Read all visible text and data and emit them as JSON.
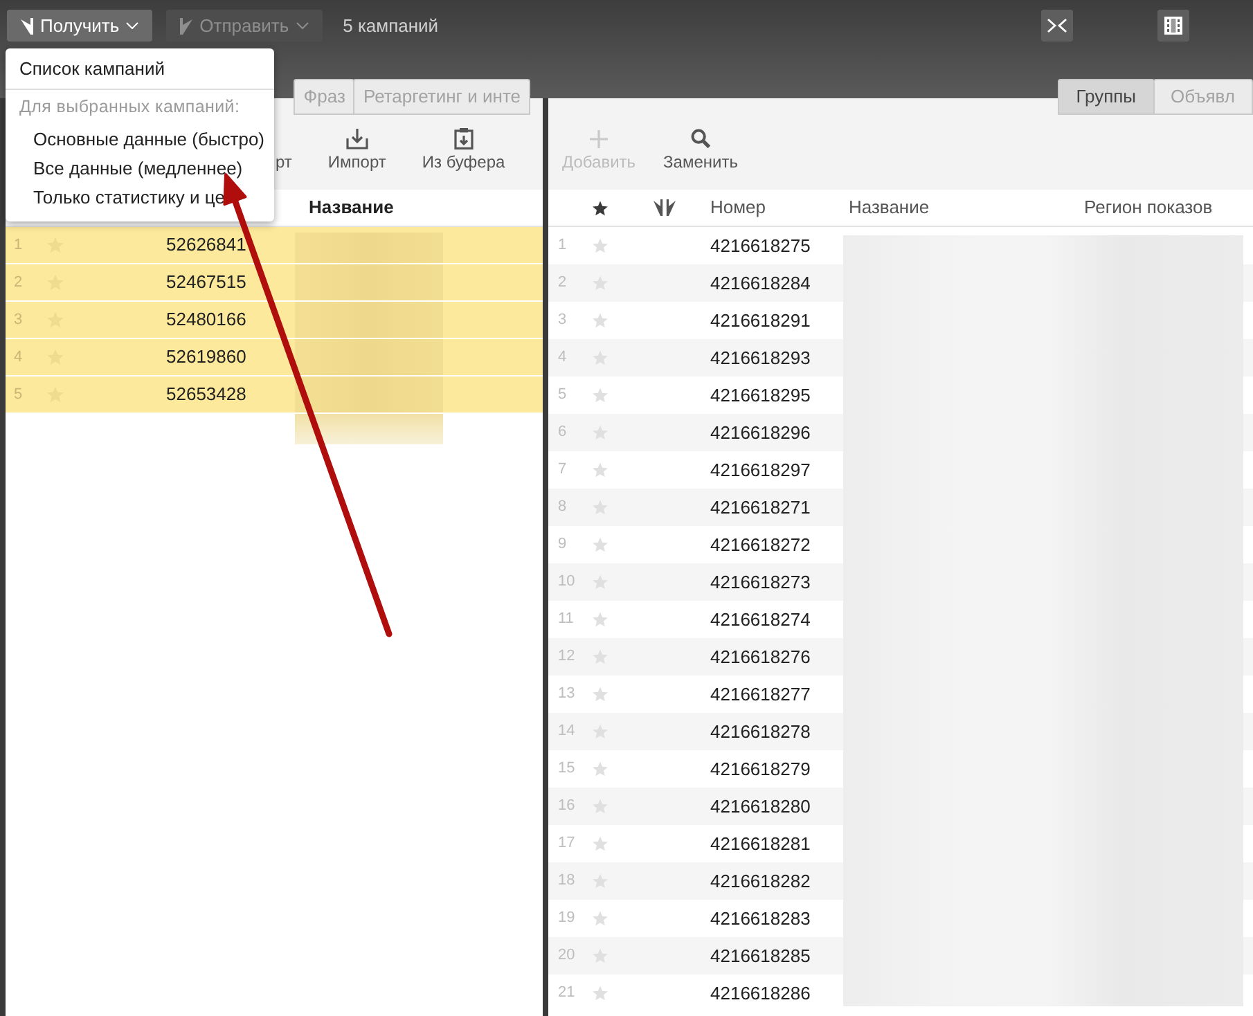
{
  "toolbar": {
    "get_button": {
      "label": "Получить",
      "expanded": true
    },
    "send_button": {
      "label": "Отправить",
      "disabled": true
    },
    "campaign_count": "5 кампаний"
  },
  "get_menu": {
    "items": [
      {
        "kind": "item",
        "label": "Список кампаний"
      },
      {
        "kind": "separator"
      },
      {
        "kind": "heading",
        "label": "Для выбранных кампаний:"
      },
      {
        "kind": "subitem",
        "label": "Основные данные (быстро)"
      },
      {
        "kind": "subitem",
        "label": "Все данные (медленнее)"
      },
      {
        "kind": "subitem",
        "label": "Только статистику и це"
      }
    ]
  },
  "campaigns_panel": {
    "tabs": [
      {
        "label": "Фраз",
        "selected": false
      },
      {
        "label": "Ретаргетинг и инте",
        "selected": false
      }
    ],
    "actions": [
      {
        "kind": "clipped",
        "label": "рт"
      },
      {
        "kind": "import",
        "label": "Импорт"
      },
      {
        "kind": "paste",
        "label": "Из буфера"
      }
    ],
    "columns": [
      "Название"
    ],
    "rows": [
      {
        "index": "1",
        "number": "52626841",
        "starred": false,
        "selected": true
      },
      {
        "index": "2",
        "number": "52467515",
        "starred": false,
        "selected": true
      },
      {
        "index": "3",
        "number": "52480166",
        "starred": false,
        "selected": true
      },
      {
        "index": "4",
        "number": "52619860",
        "starred": false,
        "selected": true
      },
      {
        "index": "5",
        "number": "52653428",
        "starred": false,
        "selected": true
      }
    ]
  },
  "groups_panel": {
    "tabs": [
      {
        "label": "Группы",
        "selected": true
      },
      {
        "label": "Объявл",
        "selected": false
      }
    ],
    "actions": [
      {
        "kind": "add",
        "label": "Добавить",
        "disabled": true
      },
      {
        "kind": "replace",
        "label": "Заменить",
        "disabled": false
      }
    ],
    "columns": [
      "Номер",
      "Название",
      "Регион показов"
    ],
    "rows": [
      {
        "index": "1",
        "number": "4216618275",
        "starred": false,
        "selected": false
      },
      {
        "index": "2",
        "number": "4216618284",
        "starred": false,
        "selected": false
      },
      {
        "index": "3",
        "number": "4216618291",
        "starred": false,
        "selected": false
      },
      {
        "index": "4",
        "number": "4216618293",
        "starred": false,
        "selected": false
      },
      {
        "index": "5",
        "number": "4216618295",
        "starred": false,
        "selected": false
      },
      {
        "index": "6",
        "number": "4216618296",
        "starred": false,
        "selected": false
      },
      {
        "index": "7",
        "number": "4216618297",
        "starred": false,
        "selected": false
      },
      {
        "index": "8",
        "number": "4216618271",
        "starred": false,
        "selected": false
      },
      {
        "index": "9",
        "number": "4216618272",
        "starred": false,
        "selected": false
      },
      {
        "index": "10",
        "number": "4216618273",
        "starred": false,
        "selected": false
      },
      {
        "index": "11",
        "number": "4216618274",
        "starred": false,
        "selected": false
      },
      {
        "index": "12",
        "number": "4216618276",
        "starred": false,
        "selected": false
      },
      {
        "index": "13",
        "number": "4216618277",
        "starred": false,
        "selected": false
      },
      {
        "index": "14",
        "number": "4216618278",
        "starred": false,
        "selected": false
      },
      {
        "index": "15",
        "number": "4216618279",
        "starred": false,
        "selected": false
      },
      {
        "index": "16",
        "number": "4216618280",
        "starred": false,
        "selected": false
      },
      {
        "index": "17",
        "number": "4216618281",
        "starred": false,
        "selected": false
      },
      {
        "index": "18",
        "number": "4216618282",
        "starred": false,
        "selected": false
      },
      {
        "index": "19",
        "number": "4216618283",
        "starred": false,
        "selected": false
      },
      {
        "index": "20",
        "number": "4216618285",
        "starred": false,
        "selected": false
      },
      {
        "index": "21",
        "number": "4216618286",
        "starred": false,
        "selected": false
      }
    ]
  }
}
